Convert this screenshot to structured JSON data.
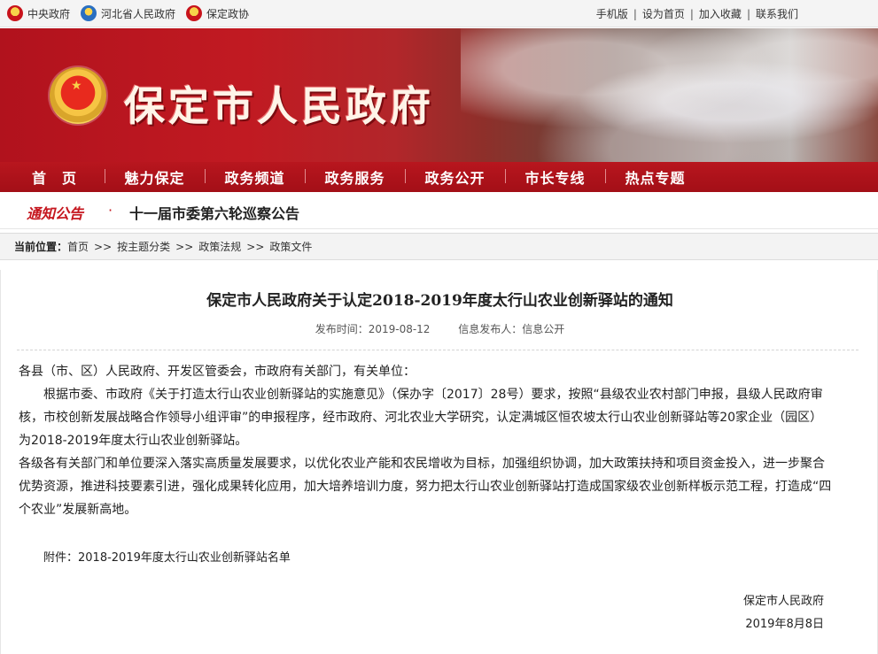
{
  "topbar": {
    "left_links": [
      {
        "label": "中央政府",
        "icon": "national-emblem-icon"
      },
      {
        "label": "河北省人民政府",
        "icon": "hebei-emblem-icon"
      },
      {
        "label": "保定政协",
        "icon": "cppcc-emblem-icon"
      }
    ],
    "right_links": [
      "手机版",
      "设为首页",
      "加入收藏",
      "联系我们"
    ],
    "separator": "|"
  },
  "banner": {
    "site_title": "保定市人民政府"
  },
  "nav": {
    "items": [
      "首　页",
      "魅力保定",
      "政务频道",
      "政务服务",
      "政务公开",
      "市长专线",
      "热点专题"
    ]
  },
  "notice": {
    "label": "通知公告",
    "bullet": "·",
    "text": "十一届市委第六轮巡察公告"
  },
  "breadcrumb": {
    "current_label": "当前位置：",
    "items": [
      "首页",
      "按主题分类",
      "政策法规",
      "政策文件"
    ],
    "separator": ">>"
  },
  "article": {
    "title": "保定市人民政府关于认定2018-2019年度太行山农业创新驿站的通知",
    "publish_time": "发布时间：2019-08-12",
    "publisher": "信息发布人：信息公开",
    "salutation": "各县（市、区）人民政府、开发区管委会，市政府有关部门，有关单位：",
    "paragraph1": "根据市委、市政府《关于打造太行山农业创新驿站的实施意见》（保办字〔2017〕28号）要求，按照“县级农业农村部门申报，县级人民政府审核，市校创新发展战略合作领导小组评审”的申报程序，经市政府、河北农业大学研究，认定满城区恒农坡太行山农业创新驿站等20家企业（园区）为2018-2019年度太行山农业创新驿站。",
    "paragraph2": "各级各有关部门和单位要深入落实高质量发展要求，以优化农业产能和农民增收为目标，加强组织协调，加大政策扶持和项目资金投入，进一步聚合优势资源，推进科技要素引进，强化成果转化应用，加大培养培训力度，努力把太行山农业创新驿站打造成国家级农业创新样板示范工程，打造成“四个农业”发展新高地。",
    "attachment": "附件：2018-2019年度太行山农业创新驿站名单",
    "signature": "保定市人民政府",
    "date": "2019年8月8日"
  }
}
